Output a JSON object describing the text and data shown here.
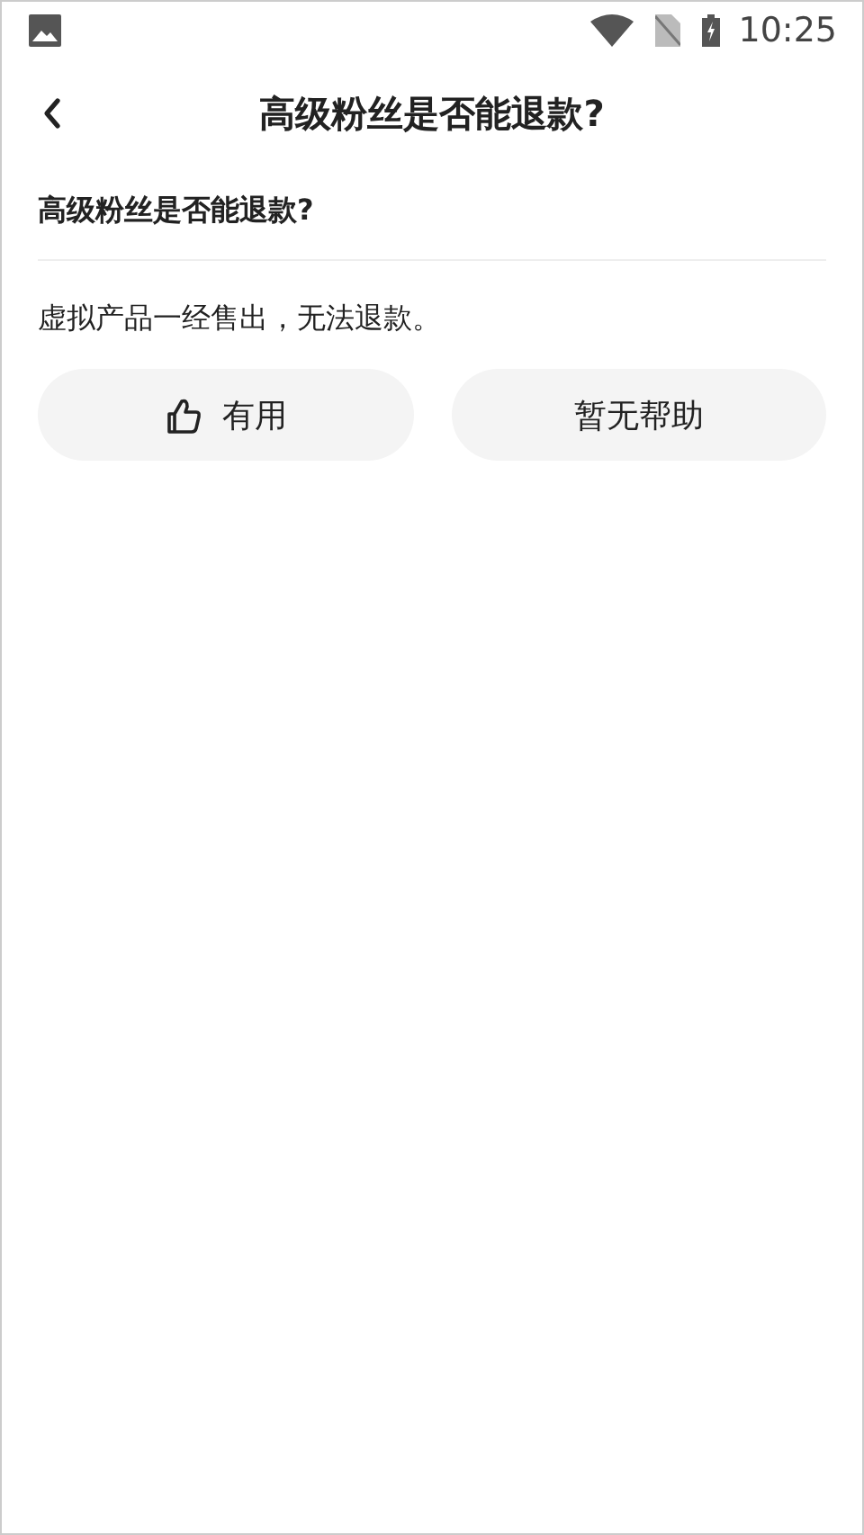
{
  "status_bar": {
    "time": "10:25"
  },
  "header": {
    "title": "高级粉丝是否能退款?"
  },
  "question": "高级粉丝是否能退款?",
  "answer": "虚拟产品一经售出，无法退款。",
  "feedback_buttons": [
    {
      "kind": "thumb",
      "label": "有用"
    },
    {
      "kind": "plain",
      "label": "暂无帮助"
    }
  ]
}
